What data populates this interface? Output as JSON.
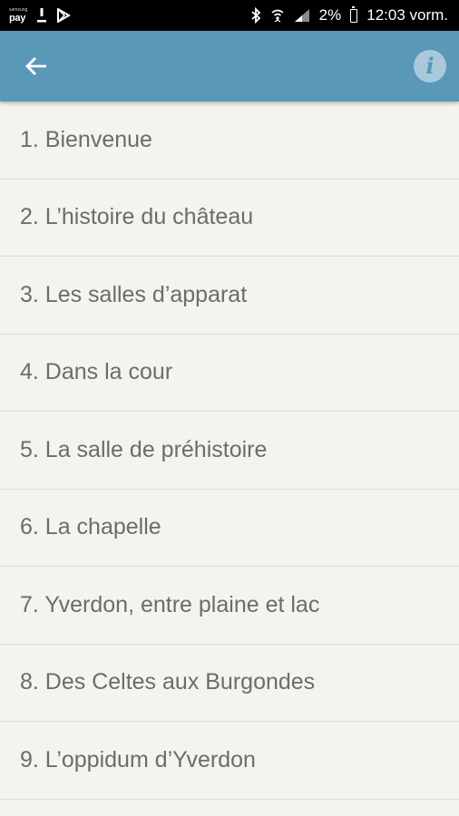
{
  "status_bar": {
    "pay_small": "samsung",
    "pay_label": "pay",
    "download_icon": "download-icon",
    "play_icon": "play-store-icon",
    "bluetooth_icon": "bluetooth-icon",
    "wifi_icon": "wifi-icon",
    "signal_icon": "signal-icon",
    "battery_percent": "2%",
    "battery_icon": "battery-icon",
    "time": "12:03 vorm."
  },
  "app_bar": {
    "back_icon": "arrow-left-icon",
    "info_label": "i",
    "color": "#5a98b8"
  },
  "list": {
    "items": [
      {
        "label": "1. Bienvenue"
      },
      {
        "label": "2. L’histoire du château"
      },
      {
        "label": "3. Les salles d’apparat"
      },
      {
        "label": "4. Dans la cour"
      },
      {
        "label": "5. La salle de préhistoire"
      },
      {
        "label": "6. La chapelle"
      },
      {
        "label": "7. Yverdon, entre plaine et lac"
      },
      {
        "label": "8. Des Celtes aux Burgondes"
      },
      {
        "label": "9. L’oppidum d’Yverdon"
      }
    ]
  }
}
